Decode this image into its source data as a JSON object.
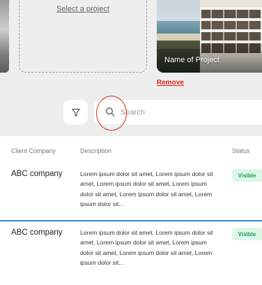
{
  "projects": {
    "select_label": "Select a project",
    "card_name": "Name of Project",
    "remove_label": "Remove"
  },
  "toolbar": {
    "filter_icon": "filter-icon",
    "search_icon": "search-icon",
    "search_placeholder": "Search"
  },
  "table": {
    "headers": {
      "client": "Client Company",
      "description": "Description",
      "status": "Status"
    },
    "rows": [
      {
        "client": "ABC company",
        "description": "Lorem ipsum dolor sit amet, Lorem ipsum dolor sit amet, Lorem ipsum dolor sit amet, Lorem ipsum dolor sit amet, Lorem ipsum dolor sit amet, Lorem ipsum dolor sit...",
        "status": "Visible"
      },
      {
        "client": "ABC company",
        "description": "Lorem ipsum dolor sit amet, Lorem ipsum dolor sit amet, Lorem ipsum dolor sit amet, Lorem ipsum dolor sit amet, Lorem ipsum dolor sit amet, Lorem ipsum dolor sit...",
        "status": "Visible"
      }
    ]
  },
  "colors": {
    "accent_blue": "#2d86d9",
    "remove_red": "#e2231a",
    "annotation_red": "#d62b1e",
    "visible_badge_bg": "#dcf7e7",
    "visible_badge_text": "#1f9a55"
  }
}
